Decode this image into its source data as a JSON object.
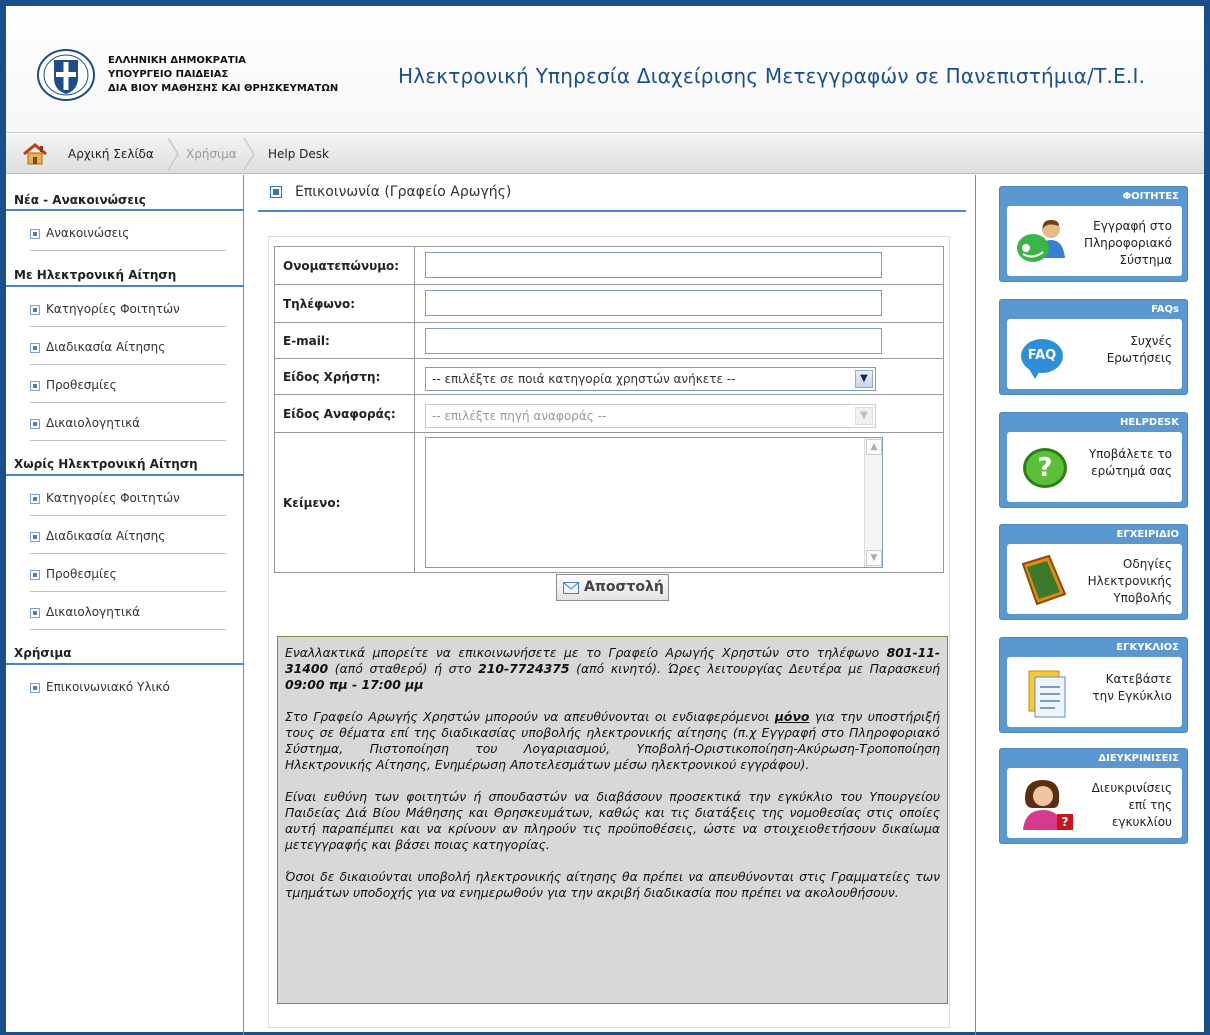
{
  "header": {
    "ministry": [
      "ΕΛΛΗΝΙΚΗ ΔΗΜΟΚΡΑΤΙΑ",
      "ΥΠΟΥΡΓΕΙΟ ΠΑΙΔΕΙΑΣ",
      "ΔΙΑ ΒΙΟΥ ΜΑΘΗΣΗΣ ΚΑΙ ΘΡΗΣΚΕΥΜΑΤΩΝ"
    ],
    "site_title": "Ηλεκτρονική Υπηρεσία Διαχείρισης Μετεγγραφών σε Πανεπιστήμια/Τ.Ε.Ι."
  },
  "breadcrumb": {
    "home": "Αρχική Σελίδα",
    "useful": "Χρήσιμα",
    "helpdesk": "Help Desk"
  },
  "sidebar": {
    "sections": [
      {
        "title": "Νέα - Ανακοινώσεις",
        "items": [
          "Ανακοινώσεις"
        ]
      },
      {
        "title": "Με Ηλεκτρονική Αίτηση",
        "items": [
          "Κατηγορίες Φοιτητών",
          "Διαδικασία Αίτησης",
          "Προθεσμίες",
          "Δικαιολογητικά"
        ]
      },
      {
        "title": "Χωρίς Ηλεκτρονική Αίτηση",
        "items": [
          "Κατηγορίες Φοιτητών",
          "Διαδικασία Αίτησης",
          "Προθεσμίες",
          "Δικαιολογητικά"
        ]
      },
      {
        "title": "Χρήσιμα",
        "items": [
          "Επικοινωνιακό Υλικό"
        ]
      }
    ]
  },
  "main": {
    "heading": "Επικοινωνία (Γραφείο Αρωγής)",
    "form": {
      "name_label": "Ονοματεπώνυμο:",
      "phone_label": "Τηλέφωνο:",
      "email_label": "E-mail:",
      "user_type_label": "Είδος Χρήστη:",
      "user_type_value": "-- επιλέξτε σε ποιά κατηγορία χρηστών ανήκετε --",
      "report_type_label": "Είδος Αναφοράς:",
      "report_type_value": "-- επιλέξτε πηγή αναφοράς --",
      "text_label": "Κείμενο:",
      "send_label": "Αποστολή"
    },
    "info": {
      "p1_a": "Εναλλακτικά μπορείτε να επικοινωνήσετε με το Γραφείο Αρωγής Χρηστών στο τηλέφωνο ",
      "p1_phone1": "801-11-31400",
      "p1_b": " (από σταθερό) ή στο ",
      "p1_phone2": "210-7724375",
      "p1_c": " (από κινητό). Ώρες λειτουργίας Δευτέρα με Παρασκευή ",
      "p1_hours": "09:00 πμ - 17:00 μμ",
      "p2_a": "Στο Γραφείο Αρωγής Χρηστών μπορούν να απευθύνονται οι ενδιαφερόμενοι ",
      "p2_only": "μόνο",
      "p2_b": " για την υποστήριξή τους σε θέματα επί της διαδικασίας υποβολής ηλεκτρονικής αίτησης (π.χ Εγγραφή στο Πληροφοριακό Σύστημα, Πιστοποίηση του Λογαριασμού, Υποβολή-Οριστικοποίηση-Ακύρωση-Τροποποίηση Ηλεκτρονικής Αίτησης, Ενημέρωση Αποτελεσμάτων μέσω ηλεκτρονικού εγγράφου).",
      "p3": "Είναι ευθύνη των φοιτητών ή σπουδαστών να διαβάσουν προσεκτικά την εγκύκλιο του Υπουργείου Παιδείας Διά Βίου Μάθησης και Θρησκευμάτων, καθώς και τις διατάξεις της νομοθεσίας στις οποίες αυτή παραπέμπει και να κρίνουν αν πληρούν τις προϋποθέσεις, ώστε να στοιχειοθετήσουν δικαίωμα μετεγγραφής και βάσει ποιας κατηγορίας.",
      "p4": "Όσοι δε δικαιούνται υποβολή ηλεκτρονικής αίτησης θα πρέπει να απευθύνονται στις Γραμματείες των τμημάτων υποδοχής για να ενημερωθούν για την ακριβή διαδικασία που πρέπει να ακολουθήσουν."
    }
  },
  "cards": [
    {
      "title": "ΦΟΙΤΗΤΕΣ",
      "lines": [
        "Εγγραφή στο",
        "Πληροφοριακό",
        "Σύστημα"
      ],
      "icon": "students-icon"
    },
    {
      "title": "FAQs",
      "lines": [
        "Συχνές",
        "Ερωτήσεις"
      ],
      "icon": "faq-icon",
      "badge": "FAQ"
    },
    {
      "title": "HELPDESK",
      "lines": [
        "Υποβάλετε το",
        "ερώτημά σας"
      ],
      "icon": "question-icon",
      "badge": "?"
    },
    {
      "title": "ΕΓΧΕΙΡΙΔΙΟ",
      "lines": [
        "Οδηγίες",
        "Ηλεκτρονικής",
        "Υποβολής"
      ],
      "icon": "manual-icon"
    },
    {
      "title": "ΕΓΚΥΚΛΙΟΣ",
      "lines": [
        "Κατεβάστε",
        "την Εγκύκλιο"
      ],
      "icon": "document-icon"
    },
    {
      "title": "ΔΙΕΥΚΡΙΝΙΣΕΙΣ",
      "lines": [
        "Διευκρινίσεις",
        "επί της",
        "εγκυκλίου"
      ],
      "icon": "support-woman-icon",
      "badge": "?"
    }
  ],
  "colors": {
    "accent": "#1b4f87",
    "line": "#4a86c5",
    "card": "#5b98d0"
  }
}
